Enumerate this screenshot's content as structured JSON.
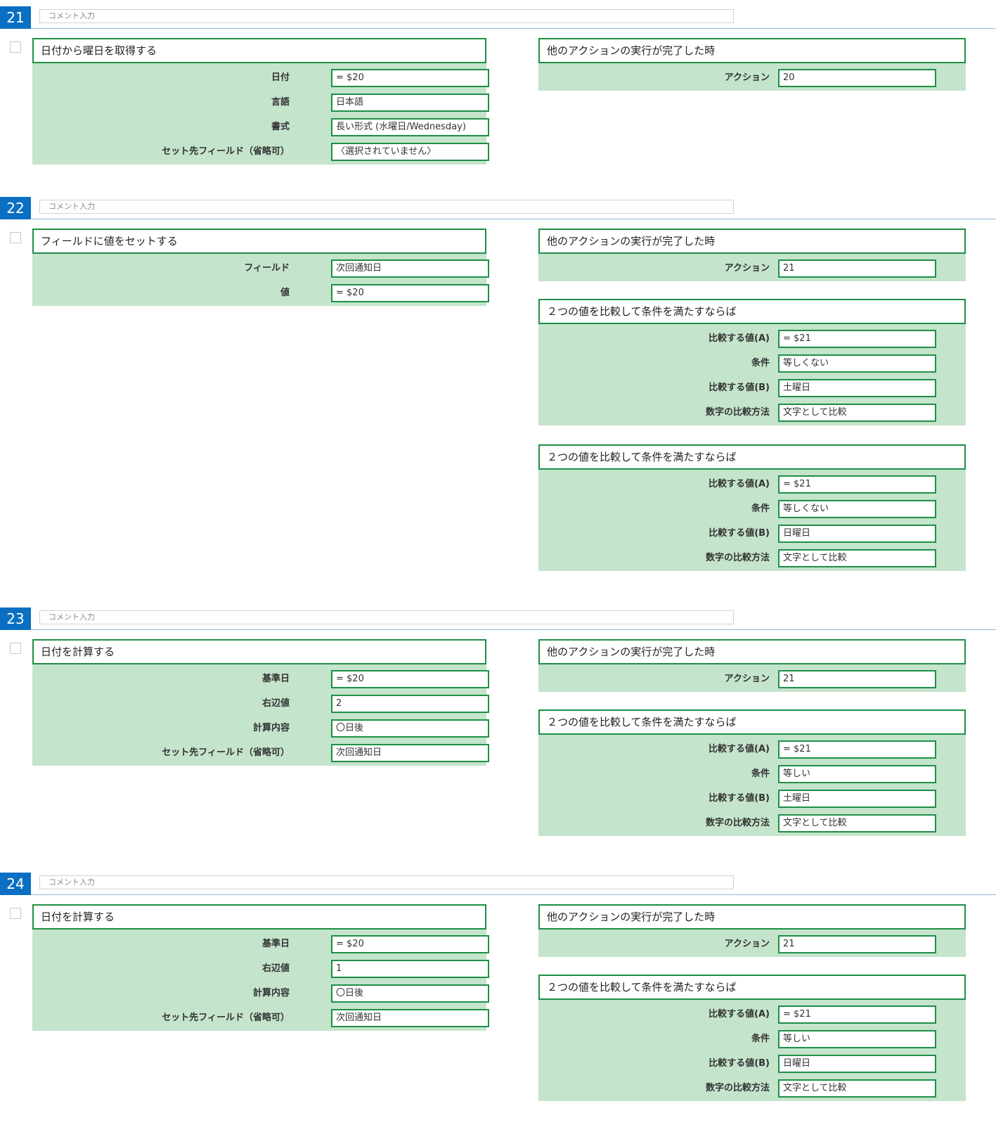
{
  "comment_placeholder": "コメント入力",
  "steps": [
    {
      "num": "21",
      "left": {
        "title": "日付から曜日を取得する",
        "fields": [
          {
            "label": "日付",
            "value": "= $20"
          },
          {
            "label": "言語",
            "value": "日本語"
          },
          {
            "label": "書式",
            "value": "長い形式 (水曜日/Wednesday)"
          },
          {
            "label": "セット先フィールド（省略可）",
            "value": "〈選択されていません〉"
          }
        ]
      },
      "right": [
        {
          "title": "他のアクションの実行が完了した時",
          "fields": [
            {
              "label": "アクション",
              "value": "20"
            }
          ]
        }
      ]
    },
    {
      "num": "22",
      "left": {
        "title": "フィールドに値をセットする",
        "fields": [
          {
            "label": "フィールド",
            "value": "次回通知日"
          },
          {
            "label": "値",
            "value": "= $20"
          }
        ]
      },
      "right": [
        {
          "title": "他のアクションの実行が完了した時",
          "fields": [
            {
              "label": "アクション",
              "value": "21"
            }
          ]
        },
        {
          "title": "２つの値を比較して条件を満たすならば",
          "fields": [
            {
              "label": "比較する値(A)",
              "value": "= $21"
            },
            {
              "label": "条件",
              "value": "等しくない"
            },
            {
              "label": "比較する値(B)",
              "value": "土曜日"
            },
            {
              "label": "数字の比較方法",
              "value": "文字として比較"
            }
          ]
        },
        {
          "title": "２つの値を比較して条件を満たすならば",
          "fields": [
            {
              "label": "比較する値(A)",
              "value": "= $21"
            },
            {
              "label": "条件",
              "value": "等しくない"
            },
            {
              "label": "比較する値(B)",
              "value": "日曜日"
            },
            {
              "label": "数字の比較方法",
              "value": "文字として比較"
            }
          ]
        }
      ]
    },
    {
      "num": "23",
      "left": {
        "title": "日付を計算する",
        "fields": [
          {
            "label": "基準日",
            "value": "= $20"
          },
          {
            "label": "右辺値",
            "value": "2"
          },
          {
            "label": "計算内容",
            "value": "〇日後"
          },
          {
            "label": "セット先フィールド（省略可）",
            "value": "次回通知日"
          }
        ]
      },
      "right": [
        {
          "title": "他のアクションの実行が完了した時",
          "fields": [
            {
              "label": "アクション",
              "value": "21"
            }
          ]
        },
        {
          "title": "２つの値を比較して条件を満たすならば",
          "fields": [
            {
              "label": "比較する値(A)",
              "value": "= $21"
            },
            {
              "label": "条件",
              "value": "等しい"
            },
            {
              "label": "比較する値(B)",
              "value": "土曜日"
            },
            {
              "label": "数字の比較方法",
              "value": "文字として比較"
            }
          ]
        }
      ]
    },
    {
      "num": "24",
      "left": {
        "title": "日付を計算する",
        "fields": [
          {
            "label": "基準日",
            "value": "= $20"
          },
          {
            "label": "右辺値",
            "value": "1"
          },
          {
            "label": "計算内容",
            "value": "〇日後"
          },
          {
            "label": "セット先フィールド（省略可）",
            "value": "次回通知日"
          }
        ]
      },
      "right": [
        {
          "title": "他のアクションの実行が完了した時",
          "fields": [
            {
              "label": "アクション",
              "value": "21"
            }
          ]
        },
        {
          "title": "２つの値を比較して条件を満たすならば",
          "fields": [
            {
              "label": "比較する値(A)",
              "value": "= $21"
            },
            {
              "label": "条件",
              "value": "等しい"
            },
            {
              "label": "比較する値(B)",
              "value": "日曜日"
            },
            {
              "label": "数字の比較方法",
              "value": "文字として比較"
            }
          ]
        }
      ]
    }
  ]
}
